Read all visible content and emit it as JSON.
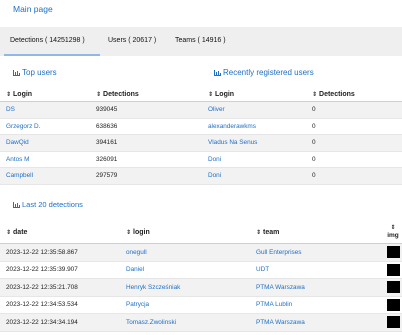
{
  "nav": {
    "main_page": "Main page"
  },
  "tabs": [
    {
      "label": "Detections ( 14251298 )"
    },
    {
      "label": "Users ( 20617 )"
    },
    {
      "label": "Teams ( 14916 )"
    }
  ],
  "sort_glyph": "⇕",
  "top_users": {
    "link": "Top users",
    "headers": [
      "Login",
      "Detections"
    ],
    "rows": [
      {
        "login": "DS",
        "detections": "939045"
      },
      {
        "login": "Grzegorz D.",
        "detections": "638636"
      },
      {
        "login": "DawQid",
        "detections": "394161"
      },
      {
        "login": "Antos M",
        "detections": "326091"
      },
      {
        "login": "Campbell",
        "detections": "297579"
      }
    ]
  },
  "recent_users": {
    "link": "Recently registered users",
    "headers": [
      "Login",
      "Detections"
    ],
    "rows": [
      {
        "login": "Oliver",
        "detections": "0"
      },
      {
        "login": "alexanderawkms",
        "detections": "0"
      },
      {
        "login": "Vladus Na Senus",
        "detections": "0"
      },
      {
        "login": "Doni",
        "detections": "0"
      },
      {
        "login": "Doni",
        "detections": "0"
      }
    ]
  },
  "last20": {
    "link": "Last 20 detections",
    "headers": {
      "date": "date",
      "login": "login",
      "team": "team",
      "img": "img"
    },
    "rows": [
      {
        "date": "2023-12-22 12:35:58.867",
        "login": "onegull",
        "team": "Gull Enterprises"
      },
      {
        "date": "2023-12-22 12:35:39.907",
        "login": "Daniel",
        "team": "UDT"
      },
      {
        "date": "2023-12-22 12:35:21.708",
        "login": "Henryk Szcześniak",
        "team": "PTMA Warszawa"
      },
      {
        "date": "2023-12-22 12:34:53.534",
        "login": "Patrycja",
        "team": "PTMA Lublin"
      },
      {
        "date": "2023-12-22 12:34:34.194",
        "login": "Tomasz.Zwolinski",
        "team": "PTMA Warszawa"
      }
    ]
  },
  "colors": {
    "link": "#1f6fc5",
    "tab_bar": "#efefef",
    "tab_underline": "#8fb8e8",
    "row_stripe": "#f2f2f2",
    "thumb": "#000000"
  }
}
